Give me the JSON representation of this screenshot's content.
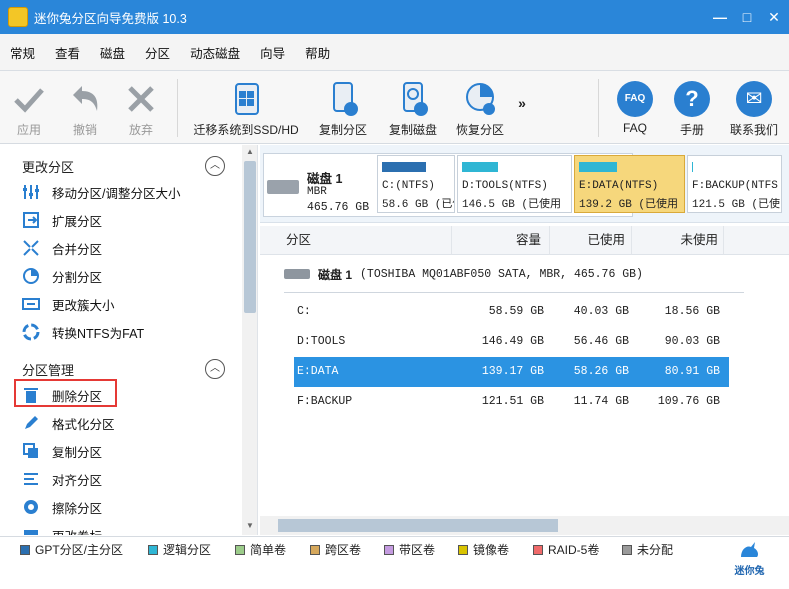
{
  "title_bar": {
    "title": "迷你兔分区向导免费版 10.3",
    "minimize": "—",
    "maximize": "□",
    "close": "✕"
  },
  "menu": [
    "常规",
    "查看",
    "磁盘",
    "分区",
    "动态磁盘",
    "向导",
    "帮助"
  ],
  "toolbar": {
    "apply": "应用",
    "undo": "撤销",
    "discard": "放弃",
    "migrate_os": "迁移系统到SSD/HD",
    "copy_partition": "复制分区",
    "copy_disk": "复制磁盘",
    "recover_partition": "恢复分区",
    "more": "»",
    "faq": "FAQ",
    "manual": "手册",
    "contact": "联系我们",
    "faq_icon_text": "FAQ",
    "manual_icon_text": "?",
    "contact_icon_text": "✉"
  },
  "sidebar": {
    "section_change": "更改分区",
    "change_items": [
      "移动分区/调整分区大小",
      "扩展分区",
      "合并分区",
      "分割分区",
      "更改簇大小",
      "转换NTFS为FAT"
    ],
    "section_manage": "分区管理",
    "manage_items": [
      "删除分区",
      "格式化分区",
      "复制分区",
      "对齐分区",
      "擦除分区",
      "更改卷标"
    ]
  },
  "disk_map": {
    "disk_name": "磁盘 1",
    "disk_type": "MBR",
    "disk_size": "465.76 GB",
    "partitions": [
      {
        "name": "C:(NTFS)",
        "detail": "58.6 GB (已使用",
        "used_pct": 69
      },
      {
        "name": "D:TOOLS(NTFS)",
        "detail": "146.5 GB (已使用",
        "used_pct": 39
      },
      {
        "name": "E:DATA(NTFS)",
        "detail": "139.2 GB (已使用",
        "used_pct": 42
      },
      {
        "name": "F:BACKUP(NTFS",
        "detail": "121.5 GB (已使",
        "used_pct": 10
      }
    ]
  },
  "table": {
    "headers": [
      "分区",
      "容量",
      "已使用",
      "未使用"
    ],
    "disk_title": "磁盘 1",
    "disk_desc": "(TOSHIBA MQ01ABF050 SATA, MBR, 465.76 GB)",
    "rows": [
      {
        "partition": "C:",
        "capacity": "58.59 GB",
        "used": "40.03 GB",
        "unused": "18.56 GB"
      },
      {
        "partition": "D:TOOLS",
        "capacity": "146.49 GB",
        "used": "56.46 GB",
        "unused": "90.03 GB"
      },
      {
        "partition": "E:DATA",
        "capacity": "139.17 GB",
        "used": "58.26 GB",
        "unused": "80.91 GB"
      },
      {
        "partition": "F:BACKUP",
        "capacity": "121.51 GB",
        "used": "11.74 GB",
        "unused": "109.76 GB"
      }
    ]
  },
  "legend": [
    {
      "label": "GPT分区/主分区",
      "color": "#2b6fb0"
    },
    {
      "label": "逻辑分区",
      "color": "#2fb6d4"
    },
    {
      "label": "简单卷",
      "color": "#9ccc8a"
    },
    {
      "label": "跨区卷",
      "color": "#d6a85c"
    },
    {
      "label": "带区卷",
      "color": "#c49be0"
    },
    {
      "label": "镜像卷",
      "color": "#d9c400"
    },
    {
      "label": "RAID-5卷",
      "color": "#f06a6a"
    },
    {
      "label": "未分配",
      "color": "#9a9a9a"
    }
  ],
  "brand": "迷你兔",
  "colors": {
    "titlebar": "#2a86d9",
    "selection": "#2b93e2",
    "highlight": "#e53935"
  }
}
